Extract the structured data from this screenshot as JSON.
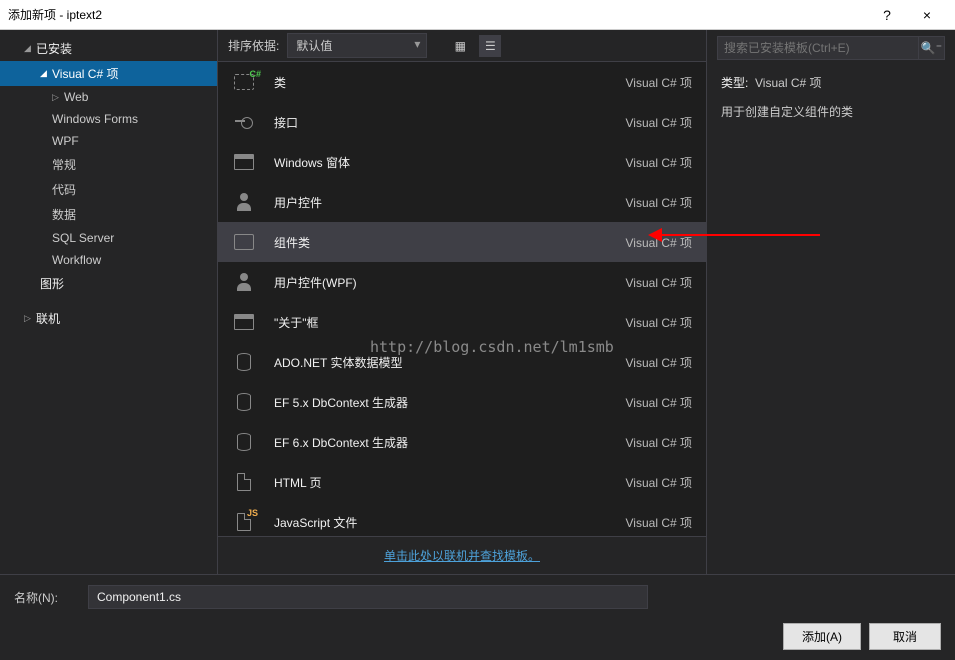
{
  "titlebar": {
    "title": "添加新项 - iptext2",
    "help": "?",
    "close": "×"
  },
  "sidebar": {
    "installed": "已安装",
    "tree": {
      "vcs": "Visual C# 项",
      "web": "Web",
      "winforms": "Windows Forms",
      "wpf": "WPF",
      "general": "常规",
      "code": "代码",
      "data": "数据",
      "sql": "SQL Server",
      "workflow": "Workflow",
      "graphics": "图形"
    },
    "online": "联机"
  },
  "toolbar": {
    "sort_label": "排序依据:",
    "sort_value": "默认值"
  },
  "templates": [
    {
      "name": "类",
      "type": "Visual C# 项",
      "icon": "class"
    },
    {
      "name": "接口",
      "type": "Visual C# 项",
      "icon": "interface"
    },
    {
      "name": "Windows 窗体",
      "type": "Visual C# 项",
      "icon": "window"
    },
    {
      "name": "用户控件",
      "type": "Visual C# 项",
      "icon": "usercontrol"
    },
    {
      "name": "组件类",
      "type": "Visual C# 项",
      "icon": "component",
      "selected": true
    },
    {
      "name": "用户控件(WPF)",
      "type": "Visual C# 项",
      "icon": "usercontrol"
    },
    {
      "name": "\"关于\"框",
      "type": "Visual C# 项",
      "icon": "about"
    },
    {
      "name": "ADO.NET 实体数据模型",
      "type": "Visual C# 项",
      "icon": "db"
    },
    {
      "name": "EF 5.x DbContext 生成器",
      "type": "Visual C# 项",
      "icon": "db"
    },
    {
      "name": "EF 6.x DbContext 生成器",
      "type": "Visual C# 项",
      "icon": "db"
    },
    {
      "name": "HTML 页",
      "type": "Visual C# 项",
      "icon": "doc"
    },
    {
      "name": "JavaScript 文件",
      "type": "Visual C# 项",
      "icon": "docjs"
    }
  ],
  "online_link": "单击此处以联机并查找模板。",
  "rightpane": {
    "search_placeholder": "搜索已安装模板(Ctrl+E)",
    "type_label": "类型:",
    "type_value": "Visual C# 项",
    "description": "用于创建自定义组件的类"
  },
  "bottom": {
    "name_label": "名称(N):",
    "name_value": "Component1.cs",
    "add": "添加(A)",
    "cancel": "取消"
  },
  "watermark": "http://blog.csdn.net/lm1smb"
}
